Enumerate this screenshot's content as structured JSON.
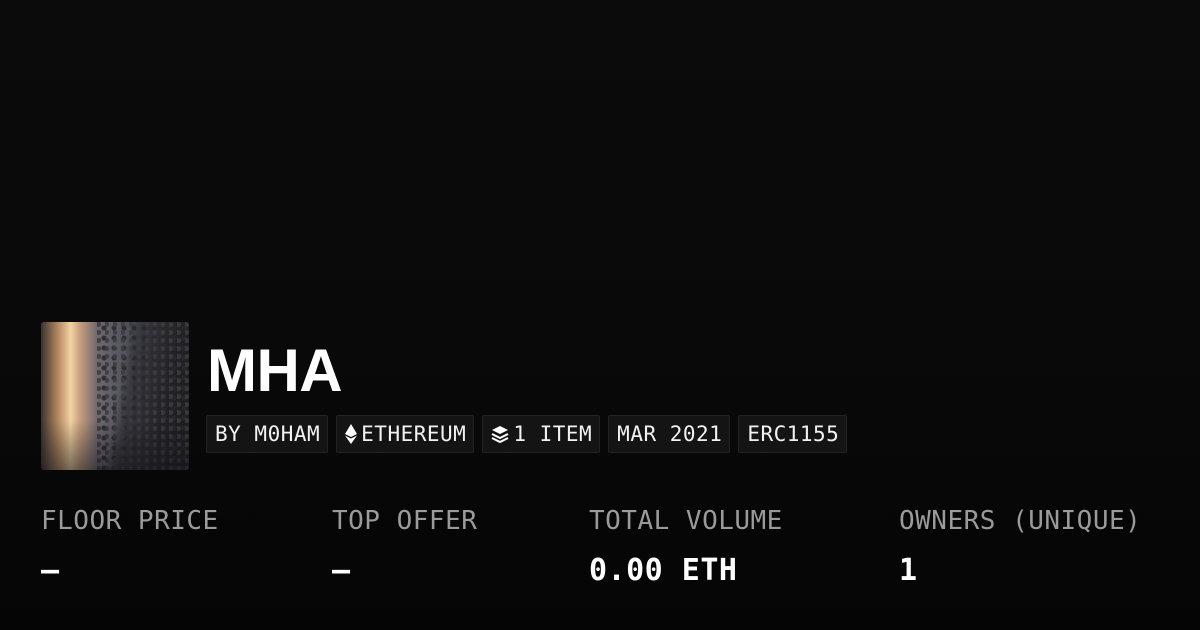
{
  "collection": {
    "name": "MHA"
  },
  "chips": {
    "creator": "BY M0HAM",
    "chain": "ETHEREUM",
    "items": "1 ITEM",
    "created": "MAR 2021",
    "standard": "ERC1155"
  },
  "icons": {
    "chain": "ethereum-icon",
    "items": "layers-icon"
  },
  "stats": {
    "floor_price": {
      "label": "FLOOR PRICE",
      "value": "—"
    },
    "top_offer": {
      "label": "TOP OFFER",
      "value": "—"
    },
    "total_volume": {
      "label": "TOTAL VOLUME",
      "value": "0.00 ETH"
    },
    "owners": {
      "label": "OWNERS (UNIQUE)",
      "value": "1"
    }
  },
  "colors": {
    "background": "#0b0b0b",
    "chip_background": "#141414",
    "label_gray": "#9a9a9a",
    "text_white": "#ffffff"
  }
}
